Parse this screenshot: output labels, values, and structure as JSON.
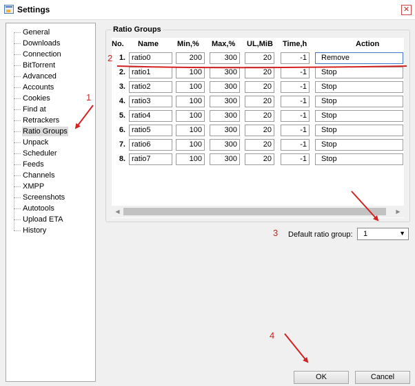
{
  "window": {
    "title": "Settings"
  },
  "nav": {
    "items": [
      "General",
      "Downloads",
      "Connection",
      "BitTorrent",
      "Advanced",
      "Accounts",
      "Cookies",
      "Find at",
      "Retrackers",
      "Ratio Groups",
      "Unpack",
      "Scheduler",
      "Feeds",
      "Channels",
      "XMPP",
      "Screenshots",
      "Autotools",
      "Upload ETA",
      "History"
    ],
    "selected": "Ratio Groups"
  },
  "ratio_groups": {
    "title": "Ratio Groups",
    "headers": {
      "no": "No.",
      "name": "Name",
      "min": "Min,%",
      "max": "Max,%",
      "ul": "UL,MiB",
      "time": "Time,h",
      "action": "Action"
    },
    "rows": [
      {
        "no": "1.",
        "name": "ratio0",
        "min": "200",
        "max": "300",
        "ul": "20",
        "time": "-1",
        "action": "Remove"
      },
      {
        "no": "2.",
        "name": "ratio1",
        "min": "100",
        "max": "300",
        "ul": "20",
        "time": "-1",
        "action": "Stop"
      },
      {
        "no": "3.",
        "name": "ratio2",
        "min": "100",
        "max": "300",
        "ul": "20",
        "time": "-1",
        "action": "Stop"
      },
      {
        "no": "4.",
        "name": "ratio3",
        "min": "100",
        "max": "300",
        "ul": "20",
        "time": "-1",
        "action": "Stop"
      },
      {
        "no": "5.",
        "name": "ratio4",
        "min": "100",
        "max": "300",
        "ul": "20",
        "time": "-1",
        "action": "Stop"
      },
      {
        "no": "6.",
        "name": "ratio5",
        "min": "100",
        "max": "300",
        "ul": "20",
        "time": "-1",
        "action": "Stop"
      },
      {
        "no": "7.",
        "name": "ratio6",
        "min": "100",
        "max": "300",
        "ul": "20",
        "time": "-1",
        "action": "Stop"
      },
      {
        "no": "8.",
        "name": "ratio7",
        "min": "100",
        "max": "300",
        "ul": "20",
        "time": "-1",
        "action": "Stop"
      }
    ]
  },
  "default_ratio": {
    "label": "Default ratio group:",
    "value": "1"
  },
  "buttons": {
    "ok": "OK",
    "cancel": "Cancel"
  },
  "annotations": [
    "1",
    "2",
    "3",
    "4"
  ],
  "colors": {
    "annotation": "#d42020",
    "selection": "#dcdcdc"
  },
  "icons": {
    "app": "settings-app-icon",
    "close": "close-icon",
    "dropdown": "chevron-down-icon"
  }
}
